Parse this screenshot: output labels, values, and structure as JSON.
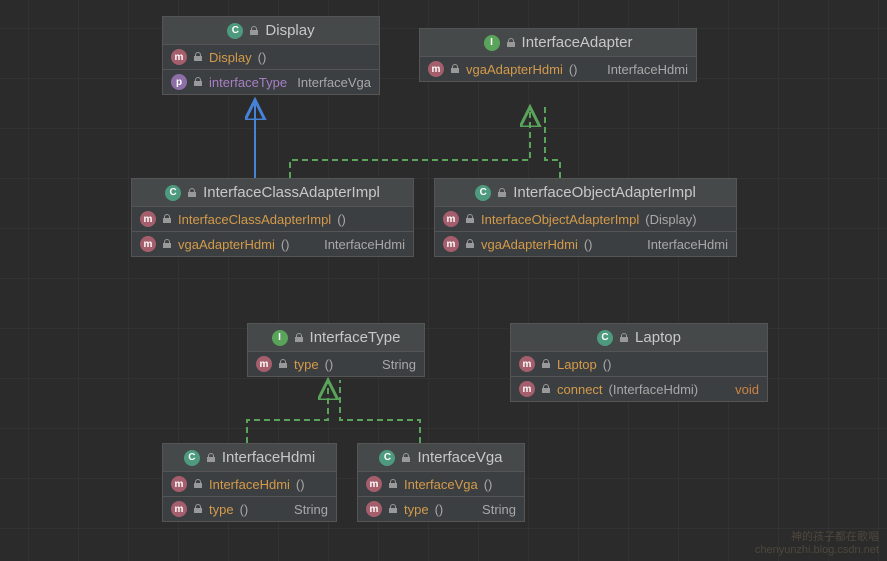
{
  "classes": {
    "display": {
      "title": "Display",
      "kind": "C",
      "rows": [
        {
          "badge": "m",
          "name": "Display",
          "params": "()",
          "type": ""
        },
        {
          "badge": "p",
          "name": "interfaceType",
          "params": "",
          "type": "InterfaceVga",
          "prop": true
        }
      ]
    },
    "interfaceAdapter": {
      "title": "InterfaceAdapter",
      "kind": "I",
      "rows": [
        {
          "badge": "m",
          "name": "vgaAdapterHdmi",
          "params": " ()",
          "type": "InterfaceHdmi"
        }
      ]
    },
    "classAdapter": {
      "title": "InterfaceClassAdapterImpl",
      "kind": "C",
      "rows": [
        {
          "badge": "m",
          "name": "InterfaceClassAdapterImpl",
          "params": "  ()",
          "type": ""
        },
        {
          "badge": "m",
          "name": "vgaAdapterHdmi",
          "params": " ()",
          "type": "InterfaceHdmi"
        }
      ]
    },
    "objectAdapter": {
      "title": "InterfaceObjectAdapterImpl",
      "kind": "C",
      "rows": [
        {
          "badge": "m",
          "name": "InterfaceObjectAdapterImpl",
          "params": " (Display)",
          "type": ""
        },
        {
          "badge": "m",
          "name": "vgaAdapterHdmi",
          "params": " ()",
          "type": "InterfaceHdmi"
        }
      ]
    },
    "interfaceType": {
      "title": "InterfaceType",
      "kind": "I",
      "rows": [
        {
          "badge": "m",
          "name": "type",
          "params": " ()",
          "type": "String"
        }
      ]
    },
    "laptop": {
      "title": "Laptop",
      "kind": "C",
      "rows": [
        {
          "badge": "m",
          "name": "Laptop",
          "params": " ()",
          "type": ""
        },
        {
          "badge": "m",
          "name": "connect",
          "params": "(InterfaceHdmi)",
          "type": "void",
          "void": true
        }
      ]
    },
    "interfaceHdmi": {
      "title": "InterfaceHdmi",
      "kind": "C",
      "rows": [
        {
          "badge": "m",
          "name": "InterfaceHdmi",
          "params": " ()",
          "type": ""
        },
        {
          "badge": "m",
          "name": "type",
          "params": " ()",
          "type": "String"
        }
      ]
    },
    "interfaceVga": {
      "title": "InterfaceVga",
      "kind": "C",
      "rows": [
        {
          "badge": "m",
          "name": "InterfaceVga",
          "params": " ()",
          "type": ""
        },
        {
          "badge": "m",
          "name": "type",
          "params": " ()",
          "type": "String"
        }
      ]
    }
  },
  "watermark": {
    "line1": "神的孩子都在歌唱",
    "line2": "chenyunzhi.blog.csdn.net"
  }
}
